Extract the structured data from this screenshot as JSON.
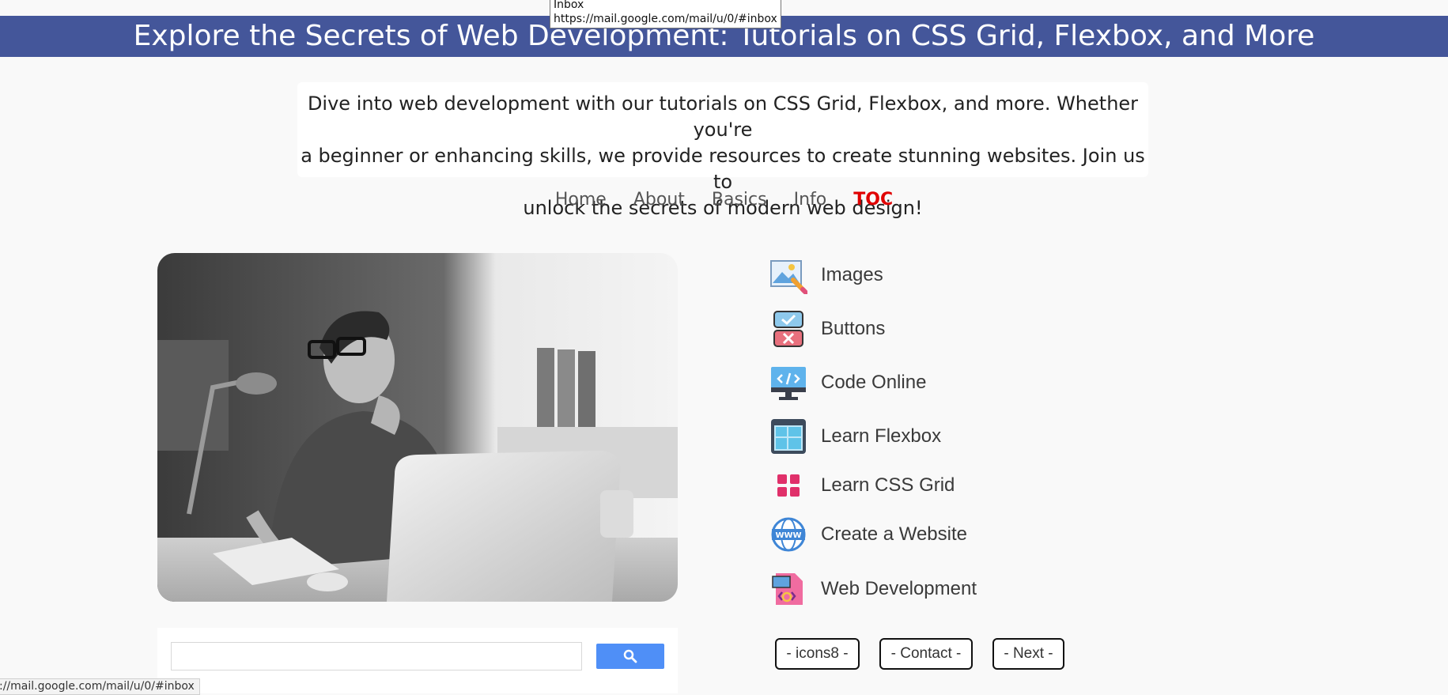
{
  "tooltip": {
    "title": "Inbox",
    "url": "https://mail.google.com/mail/u/0/#inbox"
  },
  "header": {
    "title": "Explore the Secrets of Web Development: Tutorials on CSS Grid, Flexbox, and More"
  },
  "intro": {
    "line1": "Dive into web development with our tutorials on CSS Grid, Flexbox, and more. Whether you're",
    "line2": "a beginner or enhancing skills, we provide resources to create stunning websites. Join us to",
    "line3": "unlock the secrets of modern web design!"
  },
  "nav": {
    "items": [
      {
        "label": "Home"
      },
      {
        "label": "About"
      },
      {
        "label": "Basics"
      },
      {
        "label": "Info"
      },
      {
        "label": "TOC",
        "active": true
      }
    ],
    "active_color": "#e00000"
  },
  "toc": {
    "items": [
      {
        "label": "Images",
        "icon": "image-edit-icon"
      },
      {
        "label": "Buttons",
        "icon": "check-cross-buttons-icon"
      },
      {
        "label": "Code Online",
        "icon": "code-monitor-icon"
      },
      {
        "label": "Learn Flexbox",
        "icon": "flexbox-layout-icon"
      },
      {
        "label": "Learn CSS Grid",
        "icon": "grid-blocks-icon"
      },
      {
        "label": "Create a Website",
        "icon": "www-globe-icon"
      },
      {
        "label": "Web Development",
        "icon": "web-dev-file-icon"
      }
    ]
  },
  "footer_buttons": {
    "icons8": "- icons8 -",
    "contact": "- Contact -",
    "next": "- Next -"
  },
  "search": {
    "icon": "search-icon"
  },
  "statusbar": {
    "text": "://mail.google.com/mail/u/0/#inbox"
  },
  "colors": {
    "banner": "#44569a",
    "search_button": "#4f8ff7"
  }
}
